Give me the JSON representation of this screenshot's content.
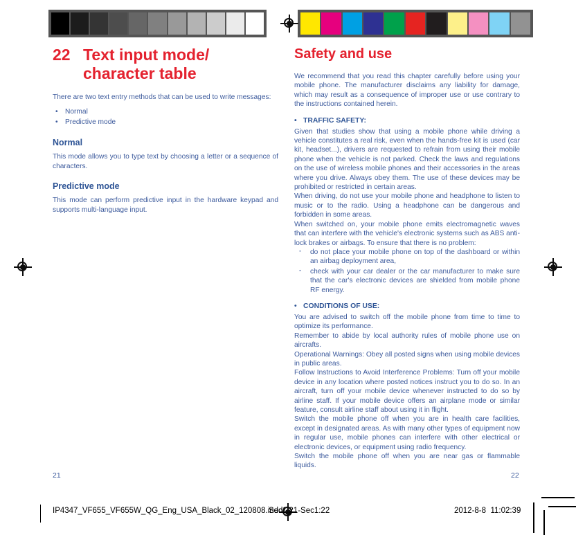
{
  "prepress": {
    "gray_wedge_label": "grayscale-step-wedge",
    "gray_swatches": [
      "#000000",
      "#1c1c1c",
      "#343434",
      "#4d4d4d",
      "#666666",
      "#808080",
      "#999999",
      "#b3b3b3",
      "#cccccc",
      "#ebebeb",
      "#ffffff"
    ],
    "color_swatches": [
      "#ffe700",
      "#e6007e",
      "#00a0e3",
      "#2e3192",
      "#00a14b",
      "#e52421",
      "#211d1e",
      "#fdf08a",
      "#f490c1",
      "#7fd3f5",
      "#929292"
    ],
    "color_swatch_names": [
      "yellow",
      "magenta",
      "cyan",
      "blue",
      "green",
      "red",
      "black",
      "light-yellow",
      "pink",
      "light-cyan",
      "gray"
    ]
  },
  "colors": {
    "heading_red": "#e4222f",
    "body_blue": "#3c5a9c",
    "subhead_blue": "#2f5596"
  },
  "left_page": {
    "chapter_number": "22",
    "chapter_title_line1": "Text input mode/",
    "chapter_title_line2": "character table",
    "intro": "There are two text entry methods that can be used to write messages:",
    "bullets": [
      "Normal",
      "Predictive mode"
    ],
    "sections": [
      {
        "heading": "Normal",
        "body": "This mode allows you to type text by choosing a letter or a sequence of characters."
      },
      {
        "heading": "Predictive mode",
        "body": "This mode can perform predictive input in the hardware keypad and supports multi-language input."
      }
    ],
    "folio": "21"
  },
  "right_page": {
    "section_title": "Safety and use",
    "intro": "We recommend that you read this chapter carefully before using your mobile phone. The manufacturer disclaims any liability for damage, which may result as a consequence of improper use or use contrary to the instructions contained herein.",
    "traffic_safety": {
      "heading": "TRAFFIC SAFETY:",
      "paragraphs": [
        "Given that studies show that using a mobile phone while driving a vehicle constitutes a real risk, even when the hands-free kit is used (car kit, headset...), drivers are requested to refrain from using their mobile phone when the vehicle is not parked. Check the laws and regulations on the use of wireless mobile phones and their accessories in the areas where you drive. Always obey them. The use of these devices may be prohibited or restricted in certain areas.",
        "When driving, do not use your mobile phone and headphone to listen to music or to the radio. Using a headphone can be dangerous and forbidden in some areas.",
        "When switched on, your mobile phone emits electromagnetic waves that can interfere with the vehicle's electronic systems such as ABS anti-lock brakes or airbags. To ensure that there is no problem:"
      ],
      "dashed_items": [
        "do not place your mobile phone on top of the dashboard or within an airbag deployment area,",
        "check with your car dealer or the car manufacturer to make sure that the car's electronic devices are shielded from mobile phone RF energy."
      ]
    },
    "conditions_of_use": {
      "heading": "CONDITIONS OF USE:",
      "paragraphs": [
        "You are advised to switch off the mobile phone from time to time to optimize its performance.",
        "Remember to abide by local authority rules of mobile phone use on aircrafts.",
        "Operational Warnings: Obey all posted signs when using mobile devices in public areas.",
        "Follow Instructions to Avoid Interference Problems: Turn off your mobile device in any location where posted notices instruct you to do so. In an aircraft, turn off your mobile device whenever instructed to do so by airline staff. If your mobile device offers an airplane mode or similar feature, consult airline staff about using it in flight.",
        "Switch the mobile phone off when you are in health care facilities, except in designated areas. As with many other types of equipment now in regular use, mobile phones can interfere with other electrical or electronic devices, or equipment using radio frequency.",
        "Switch the mobile phone off when you are near gas or flammable liquids."
      ]
    },
    "folio": "22"
  },
  "slug": {
    "filename": "IP4347_VF655_VF655W_QG_Eng_USA_Black_02_120808.indd",
    "section_range": "Sec1:21-Sec1:22",
    "date": "2012-8-8",
    "time": "11:02:39"
  }
}
